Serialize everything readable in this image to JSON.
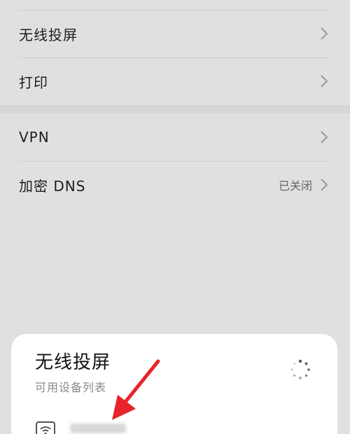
{
  "settings": {
    "items": [
      {
        "label": "无线投屏",
        "value": ""
      },
      {
        "label": "打印",
        "value": ""
      },
      {
        "label": "VPN",
        "value": ""
      },
      {
        "label": "加密 DNS",
        "value": "已关闭"
      }
    ]
  },
  "sheet": {
    "title": "无线投屏",
    "subtitle": "可用设备列表"
  },
  "icons": {
    "chevron": "chevron-right-icon",
    "spinner": "loading-spinner-icon",
    "device": "wifi-display-icon",
    "annotation": "red-arrow-icon"
  },
  "colors": {
    "annotation": "#e8232a",
    "overlay": "#e0e0e0",
    "sheet": "#ffffff"
  }
}
